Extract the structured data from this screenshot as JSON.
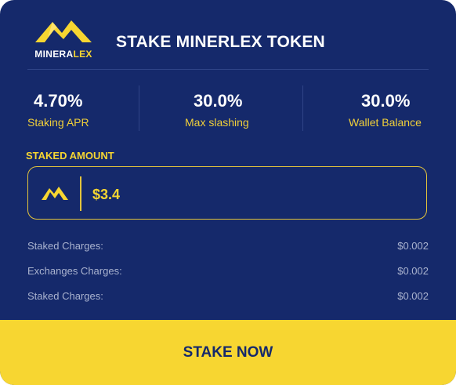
{
  "brand": {
    "logo_text_part1": "MINERA",
    "logo_text_part2": "LEX"
  },
  "header": {
    "title": "STAKE MINERLEX TOKEN"
  },
  "stats": [
    {
      "value": "4.70%",
      "label": "Staking APR"
    },
    {
      "value": "30.0%",
      "label": "Max slashing"
    },
    {
      "value": "30.0%",
      "label": "Wallet Balance"
    }
  ],
  "staked": {
    "section_label": "STAKED AMOUNT",
    "icon": "minerlex-mountain-icon",
    "amount": "$3.4"
  },
  "charges": [
    {
      "label": "Staked Charges:",
      "value": "$0.002"
    },
    {
      "label": "Exchanges Charges:",
      "value": "$0.002"
    },
    {
      "label": "Staked Charges:",
      "value": "$0.002"
    }
  ],
  "actions": {
    "stake_label": "STAKE NOW"
  },
  "colors": {
    "background": "#15296b",
    "accent": "#f7d631",
    "muted_text": "#aab3cf"
  }
}
